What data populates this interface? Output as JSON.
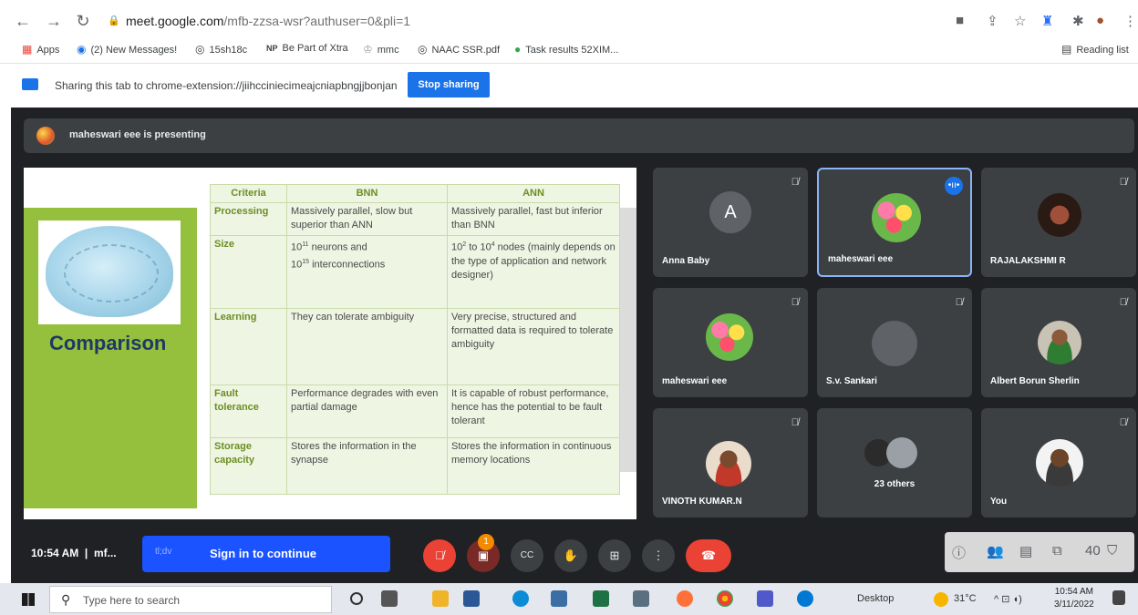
{
  "browser": {
    "url_host": "meet.google.com",
    "url_path": "/mfb-zzsa-wsr?authuser=0&pli=1",
    "bookmarks": [
      "Apps",
      "(2) New Messages!",
      "15sh18c",
      "Be Part of Xtra",
      "mmc",
      "NAAC SSR.pdf",
      "Task results 52XIM..."
    ],
    "bookmark_prefixes": {
      "np": "NP"
    },
    "reading_list": "Reading list"
  },
  "sharing": {
    "message": "Sharing this tab to chrome-extension://jiihcciniecimeajcniapbngjjbonjan",
    "stop_label": "Stop sharing",
    "accent": "#1a73e8"
  },
  "meet": {
    "presenting": "maheswari eee is presenting",
    "slide": {
      "title": "Comparison",
      "headers": [
        "Criteria",
        "BNN",
        "ANN"
      ],
      "rows": [
        {
          "criteria": "Processing",
          "bnn": "Massively parallel, slow but superior than ANN",
          "ann": "Massively parallel, fast but inferior than BNN"
        },
        {
          "criteria": "Size",
          "bnn_base1": "10",
          "bnn_exp1": "11",
          "bnn_mid": " neurons and",
          "bnn_base2": "10",
          "bnn_exp2": "15",
          "bnn_end": " interconnections",
          "ann_base1": "10",
          "ann_exp1": "2",
          "ann_mid": " to ",
          "ann_base2": "10",
          "ann_exp2": "4",
          "ann_end": " nodes (mainly depends on the type of application and network designer)"
        },
        {
          "criteria": "Learning",
          "bnn": "They can tolerate ambiguity",
          "ann": "Very precise, structured and formatted data is required to tolerate ambiguity"
        },
        {
          "criteria": "Fault tolerance",
          "bnn": "Performance degrades with even partial damage",
          "ann": "It is capable of robust performance, hence has the potential to be fault tolerant"
        },
        {
          "criteria": "Storage capacity",
          "bnn": "Stores the information in the synapse",
          "ann": "Stores the information in continuous memory locations"
        }
      ]
    },
    "participants": [
      {
        "name": "Anna Baby",
        "initial": "A"
      },
      {
        "name": "maheswari eee"
      },
      {
        "name": "RAJALAKSHMI R"
      },
      {
        "name": "maheswari eee"
      },
      {
        "name": "S.v. Sankari"
      },
      {
        "name": "Albert Borun Sherlin"
      },
      {
        "name": "VINOTH KUMAR.N"
      },
      {
        "name": "23 others"
      },
      {
        "name": "You"
      }
    ],
    "bottom": {
      "time": "10:54 AM",
      "meeting_code": "mf...",
      "signin_small": "tl;dv",
      "signin_label": "Sign in to continue",
      "cc_label": "CC",
      "chat_badge": "1",
      "people_count": "40"
    }
  },
  "taskbar": {
    "search_placeholder": "Type here to search",
    "desktop": "Desktop",
    "temp": "31°C",
    "time": "10:54 AM",
    "date": "3/11/2022"
  }
}
